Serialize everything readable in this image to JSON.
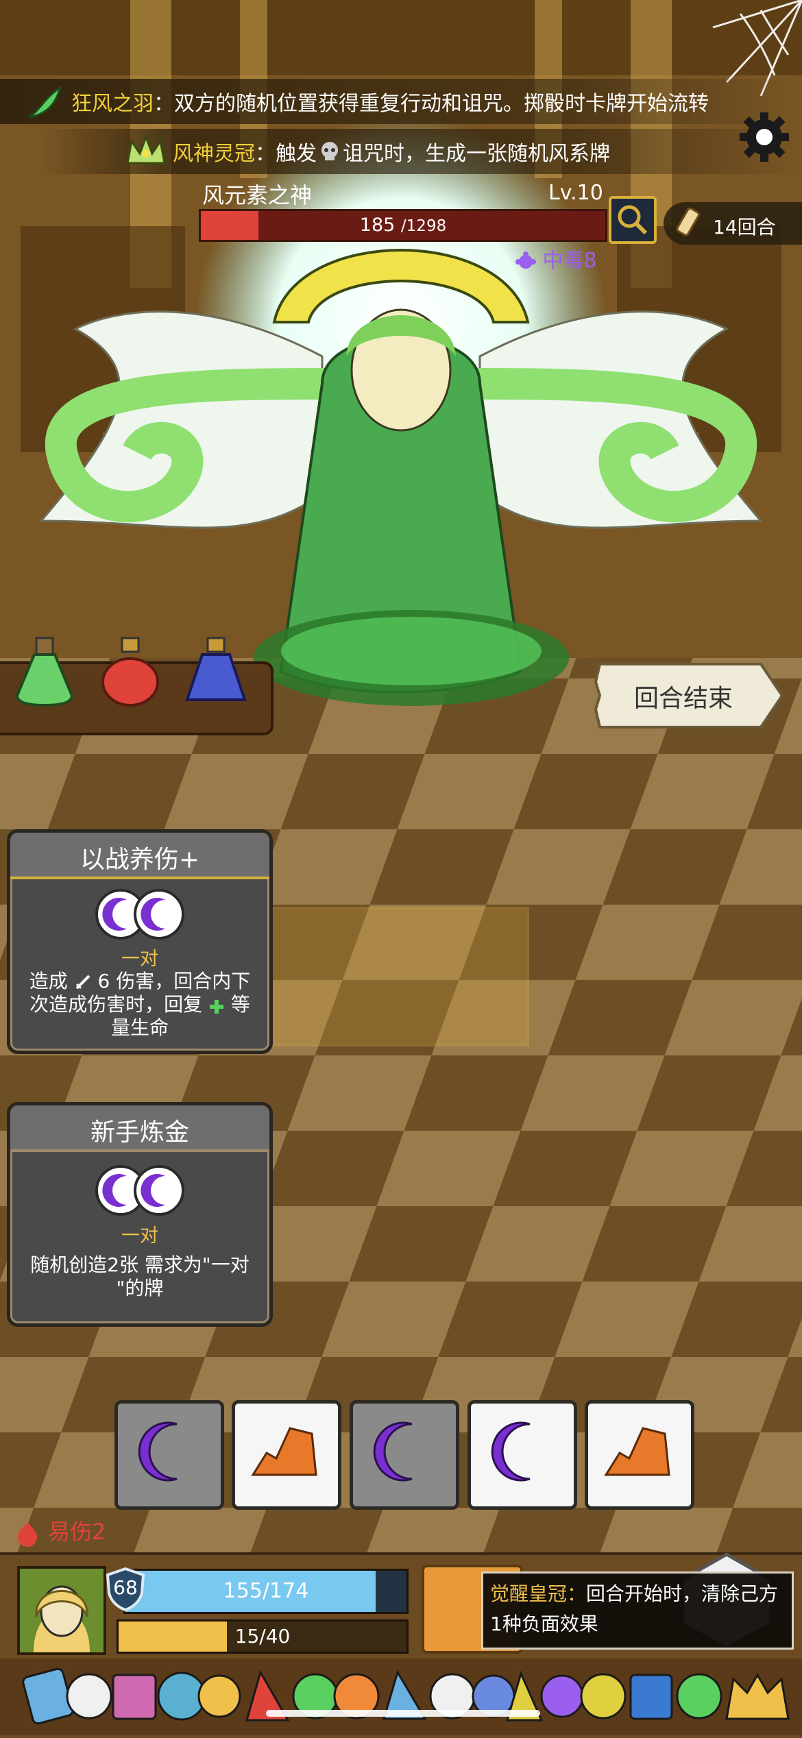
{
  "relics": [
    {
      "name": "狂风之羽",
      "sep": "：",
      "desc": "双方的随机位置获得重复行动和诅咒。掷骰时卡牌开始流转"
    },
    {
      "name": "风神灵冠",
      "sep": "：",
      "desc_pre": "触发",
      "desc_post": "诅咒时，生成一张随机风系牌"
    }
  ],
  "boss": {
    "name": "风元素之神",
    "level": "Lv.10",
    "hp": "185",
    "hp_max": "/1298",
    "hp_fraction": 0.1425,
    "status": "中毒8"
  },
  "turn_counter": "14回合",
  "end_turn_label": "回合结束",
  "cards": [
    {
      "title": "以战养伤+",
      "requirement": "一对",
      "desc_line1_pre": "造成",
      "desc_line1_val": "6",
      "desc_line1_post": "伤害，回合内下",
      "desc_line2_pre": "次造成伤害时，回复",
      "desc_line2_post": "等",
      "desc_line3": "量生命"
    },
    {
      "title": "新手炼金",
      "requirement": "一对",
      "desc_line1": "随机创造2张 需求为\"一对",
      "desc_line2": "\"的牌"
    }
  ],
  "dice": [
    "moon",
    "rock",
    "moon",
    "moon",
    "rock"
  ],
  "player": {
    "vulnerable": "易伤2",
    "armor": "68",
    "hp": "155/174",
    "hp_fraction": 0.891,
    "energy": "15/40",
    "energy_fraction": 0.375
  },
  "tooltip": {
    "name": "觉醒皇冠",
    "sep": "：",
    "desc": "回合开始时，清除己方1种负面效果"
  },
  "colors": {
    "gold_text": "#f0d03a",
    "hp_red": "#e0433a",
    "hp_blue": "#78c8f0",
    "energy_yellow": "#f0c04a",
    "moon_purple": "#7a2fd0",
    "rock_orange": "#e8782a",
    "status_purple": "#9b5ff0"
  }
}
